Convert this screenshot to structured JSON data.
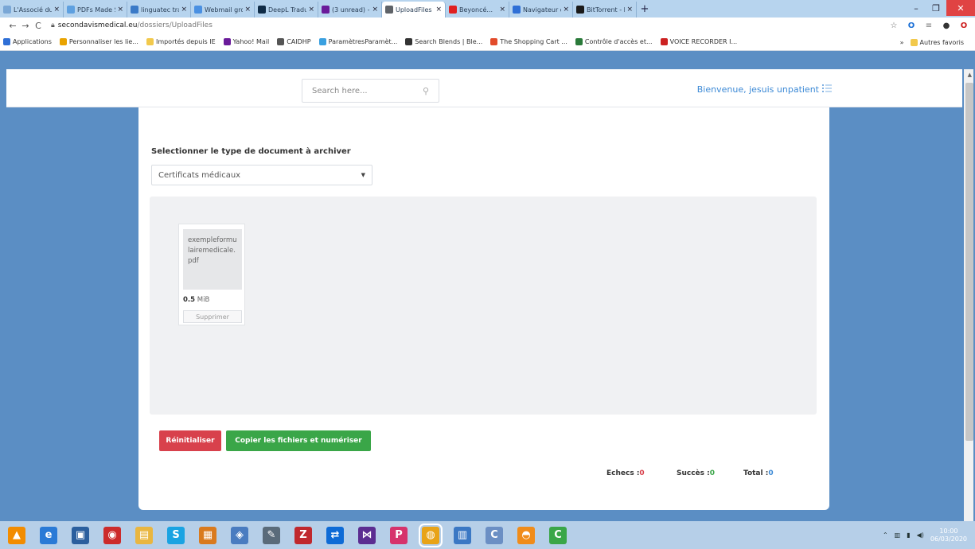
{
  "browser": {
    "tabs": [
      {
        "title": "L'Associé du...",
        "color": "#7aa7d6"
      },
      {
        "title": "PDFs Made S...",
        "color": "#5ea0e0"
      },
      {
        "title": "linguatec tran...",
        "color": "#3b7ac7"
      },
      {
        "title": "Webmail gro...",
        "color": "#4a90e2"
      },
      {
        "title": "DeepL Traduc...",
        "color": "#0f2b46"
      },
      {
        "title": "(3 unread) - ...",
        "color": "#6a1b9a"
      },
      {
        "title": "UploadFiles",
        "color": "#5f6368",
        "active": true
      },
      {
        "title": "Beyoncé...",
        "color": "#e02020"
      },
      {
        "title": "Navigateur d...",
        "color": "#2f6fd6"
      },
      {
        "title": "BitTorrent - P...",
        "color": "#1a1a1a"
      }
    ],
    "new_tab": "+",
    "url_host": "secondavismedical.eu",
    "url_path": "/dossiers/UploadFiles",
    "bookmarks": [
      {
        "label": "Applications",
        "color": "#2f6fd6"
      },
      {
        "label": "Personnaliser les lie...",
        "color": "#e9a300"
      },
      {
        "label": "Importés depuis IE",
        "color": "#f2c94c"
      },
      {
        "label": "Yahoo! Mail",
        "color": "#6a1b9a"
      },
      {
        "label": "CAIDHP",
        "color": "#555555"
      },
      {
        "label": "ParamètresParamèt...",
        "color": "#3aa0e0"
      },
      {
        "label": "Search Blends | Ble...",
        "color": "#333333"
      },
      {
        "label": "The Shopping Cart ...",
        "color": "#e24b2b"
      },
      {
        "label": "Contrôle d'accès et...",
        "color": "#2a7a3a"
      },
      {
        "label": "VOICE RECORDER I...",
        "color": "#cc2222"
      }
    ],
    "more_bookmarks": "»",
    "other_bookmarks": "Autres favoris"
  },
  "header": {
    "search_placeholder": "Search here...",
    "welcome": "Bienvenue, jesuis unpatient"
  },
  "form": {
    "doc_type_label": "Selectionner le type de document à archiver",
    "doc_type_value": "Certificats médicaux"
  },
  "file": {
    "name": "exempleformulairemedicale.pdf",
    "size_value": "0.5",
    "size_unit": "MiB",
    "remove_label": "Supprimer"
  },
  "actions": {
    "reset_label": "Réinitialiser",
    "copy_label": "Copier les fichiers et numériser"
  },
  "stats": {
    "fail_label": "Echecs :",
    "fail_value": "0",
    "success_label": "Succès :",
    "success_value": "0",
    "total_label": "Total :",
    "total_value": "0"
  },
  "taskbar": {
    "apps": [
      {
        "name": "vlc",
        "color": "#f28c00",
        "glyph": "▲"
      },
      {
        "name": "internet-explorer",
        "color": "#2a7ad6",
        "glyph": "e"
      },
      {
        "name": "app-blue",
        "color": "#2b5f9e",
        "glyph": "▣"
      },
      {
        "name": "app-red",
        "color": "#cc2b2b",
        "glyph": "◉"
      },
      {
        "name": "file-explorer",
        "color": "#e9b640",
        "glyph": "▤"
      },
      {
        "name": "skype",
        "color": "#1aa3e2",
        "glyph": "S"
      },
      {
        "name": "app-orange",
        "color": "#d97a1e",
        "glyph": "▦"
      },
      {
        "name": "network-app",
        "color": "#4a7cc0",
        "glyph": "◈"
      },
      {
        "name": "pen-tool",
        "color": "#5a6b7a",
        "glyph": "✎"
      },
      {
        "name": "filezilla",
        "color": "#c0282d",
        "glyph": "Z"
      },
      {
        "name": "teamviewer",
        "color": "#0e6bd6",
        "glyph": "⇄"
      },
      {
        "name": "visual-studio",
        "color": "#5c2d91",
        "glyph": "⋈"
      },
      {
        "name": "app-p",
        "color": "#d6336c",
        "glyph": "P"
      },
      {
        "name": "chrome",
        "color": "#e8a317",
        "glyph": "◍"
      },
      {
        "name": "app-window",
        "color": "#3b78c4",
        "glyph": "▥"
      },
      {
        "name": "app-c",
        "color": "#6b8fc4",
        "glyph": "C"
      },
      {
        "name": "app-arc",
        "color": "#f08c1a",
        "glyph": "◓"
      },
      {
        "name": "camtasia",
        "color": "#3aa648",
        "glyph": "C"
      }
    ],
    "time": "10:00",
    "date": "06/03/2020"
  }
}
